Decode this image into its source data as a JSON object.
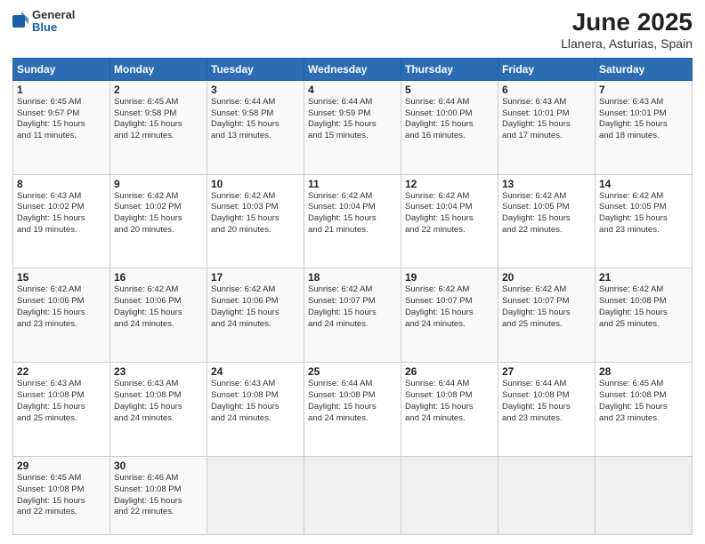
{
  "header": {
    "logo_general": "General",
    "logo_blue": "Blue",
    "title": "June 2025",
    "subtitle": "Llanera, Asturias, Spain"
  },
  "weekdays": [
    "Sunday",
    "Monday",
    "Tuesday",
    "Wednesday",
    "Thursday",
    "Friday",
    "Saturday"
  ],
  "weeks": [
    [
      {
        "day": "1",
        "info": "Sunrise: 6:45 AM\nSunset: 9:57 PM\nDaylight: 15 hours\nand 11 minutes."
      },
      {
        "day": "2",
        "info": "Sunrise: 6:45 AM\nSunset: 9:58 PM\nDaylight: 15 hours\nand 12 minutes."
      },
      {
        "day": "3",
        "info": "Sunrise: 6:44 AM\nSunset: 9:58 PM\nDaylight: 15 hours\nand 13 minutes."
      },
      {
        "day": "4",
        "info": "Sunrise: 6:44 AM\nSunset: 9:59 PM\nDaylight: 15 hours\nand 15 minutes."
      },
      {
        "day": "5",
        "info": "Sunrise: 6:44 AM\nSunset: 10:00 PM\nDaylight: 15 hours\nand 16 minutes."
      },
      {
        "day": "6",
        "info": "Sunrise: 6:43 AM\nSunset: 10:01 PM\nDaylight: 15 hours\nand 17 minutes."
      },
      {
        "day": "7",
        "info": "Sunrise: 6:43 AM\nSunset: 10:01 PM\nDaylight: 15 hours\nand 18 minutes."
      }
    ],
    [
      {
        "day": "8",
        "info": "Sunrise: 6:43 AM\nSunset: 10:02 PM\nDaylight: 15 hours\nand 19 minutes."
      },
      {
        "day": "9",
        "info": "Sunrise: 6:42 AM\nSunset: 10:02 PM\nDaylight: 15 hours\nand 20 minutes."
      },
      {
        "day": "10",
        "info": "Sunrise: 6:42 AM\nSunset: 10:03 PM\nDaylight: 15 hours\nand 20 minutes."
      },
      {
        "day": "11",
        "info": "Sunrise: 6:42 AM\nSunset: 10:04 PM\nDaylight: 15 hours\nand 21 minutes."
      },
      {
        "day": "12",
        "info": "Sunrise: 6:42 AM\nSunset: 10:04 PM\nDaylight: 15 hours\nand 22 minutes."
      },
      {
        "day": "13",
        "info": "Sunrise: 6:42 AM\nSunset: 10:05 PM\nDaylight: 15 hours\nand 22 minutes."
      },
      {
        "day": "14",
        "info": "Sunrise: 6:42 AM\nSunset: 10:05 PM\nDaylight: 15 hours\nand 23 minutes."
      }
    ],
    [
      {
        "day": "15",
        "info": "Sunrise: 6:42 AM\nSunset: 10:06 PM\nDaylight: 15 hours\nand 23 minutes."
      },
      {
        "day": "16",
        "info": "Sunrise: 6:42 AM\nSunset: 10:06 PM\nDaylight: 15 hours\nand 24 minutes."
      },
      {
        "day": "17",
        "info": "Sunrise: 6:42 AM\nSunset: 10:06 PM\nDaylight: 15 hours\nand 24 minutes."
      },
      {
        "day": "18",
        "info": "Sunrise: 6:42 AM\nSunset: 10:07 PM\nDaylight: 15 hours\nand 24 minutes."
      },
      {
        "day": "19",
        "info": "Sunrise: 6:42 AM\nSunset: 10:07 PM\nDaylight: 15 hours\nand 24 minutes."
      },
      {
        "day": "20",
        "info": "Sunrise: 6:42 AM\nSunset: 10:07 PM\nDaylight: 15 hours\nand 25 minutes."
      },
      {
        "day": "21",
        "info": "Sunrise: 6:42 AM\nSunset: 10:08 PM\nDaylight: 15 hours\nand 25 minutes."
      }
    ],
    [
      {
        "day": "22",
        "info": "Sunrise: 6:43 AM\nSunset: 10:08 PM\nDaylight: 15 hours\nand 25 minutes."
      },
      {
        "day": "23",
        "info": "Sunrise: 6:43 AM\nSunset: 10:08 PM\nDaylight: 15 hours\nand 24 minutes."
      },
      {
        "day": "24",
        "info": "Sunrise: 6:43 AM\nSunset: 10:08 PM\nDaylight: 15 hours\nand 24 minutes."
      },
      {
        "day": "25",
        "info": "Sunrise: 6:44 AM\nSunset: 10:08 PM\nDaylight: 15 hours\nand 24 minutes."
      },
      {
        "day": "26",
        "info": "Sunrise: 6:44 AM\nSunset: 10:08 PM\nDaylight: 15 hours\nand 24 minutes."
      },
      {
        "day": "27",
        "info": "Sunrise: 6:44 AM\nSunset: 10:08 PM\nDaylight: 15 hours\nand 23 minutes."
      },
      {
        "day": "28",
        "info": "Sunrise: 6:45 AM\nSunset: 10:08 PM\nDaylight: 15 hours\nand 23 minutes."
      }
    ],
    [
      {
        "day": "29",
        "info": "Sunrise: 6:45 AM\nSunset: 10:08 PM\nDaylight: 15 hours\nand 22 minutes."
      },
      {
        "day": "30",
        "info": "Sunrise: 6:46 AM\nSunset: 10:08 PM\nDaylight: 15 hours\nand 22 minutes."
      },
      {
        "day": "",
        "info": ""
      },
      {
        "day": "",
        "info": ""
      },
      {
        "day": "",
        "info": ""
      },
      {
        "day": "",
        "info": ""
      },
      {
        "day": "",
        "info": ""
      }
    ]
  ]
}
